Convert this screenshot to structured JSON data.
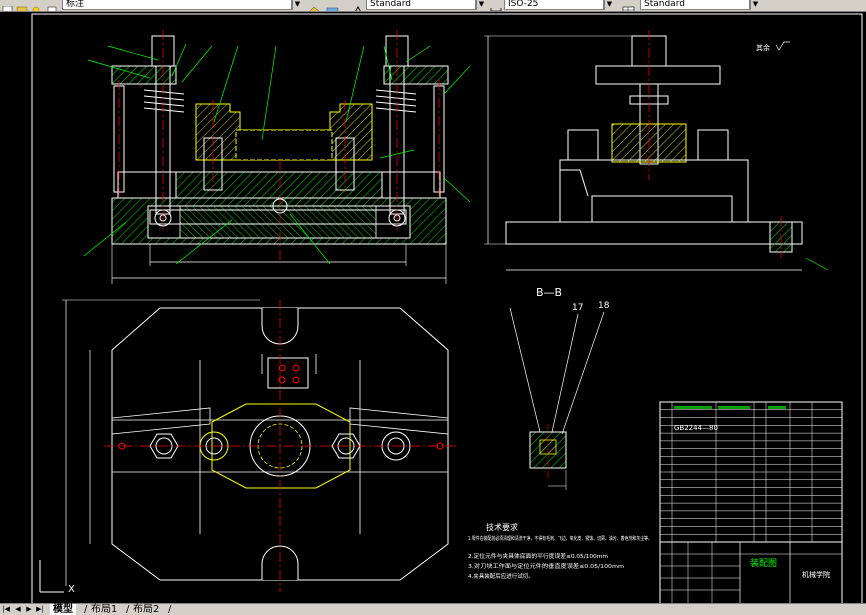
{
  "toolbar": {
    "layer_combo": "标注",
    "style_combo": "Standard",
    "dim_combo": "ISO-25",
    "table_combo": "Standard"
  },
  "drawing": {
    "section_label": "B—B",
    "section_callouts": [
      "17",
      "18"
    ],
    "roughness_label": "其余",
    "notes_title": "技术要求",
    "notes": [
      "1.零件在装配前必须清理和清洗干净，不得有毛刺、飞边、氧化皮、锈蚀、切屑、油污、着色剂和灰尘等。",
      "2.定位元件与夹具体底面的平行度误差≤0.05/100mm",
      "3.对刀块工作面与定位元件的垂直度误差≤0.05/100mm",
      "4.夹具装配后应进行试切。"
    ],
    "title_block_name": "装配图",
    "title_block_company": "机械学院",
    "bom_visible_code": "GB2244—80"
  },
  "tabs": {
    "model": "模型",
    "layout1": "布局1",
    "layout2": "布局2"
  },
  "colors": {
    "background": "#000000",
    "line_white": "#ffffff",
    "line_yellow": "#ffff00",
    "hatch_green": "#00c000",
    "center_red": "#ff0000",
    "dim_cyan": "#00ffff",
    "leader_green": "#00ff00"
  }
}
